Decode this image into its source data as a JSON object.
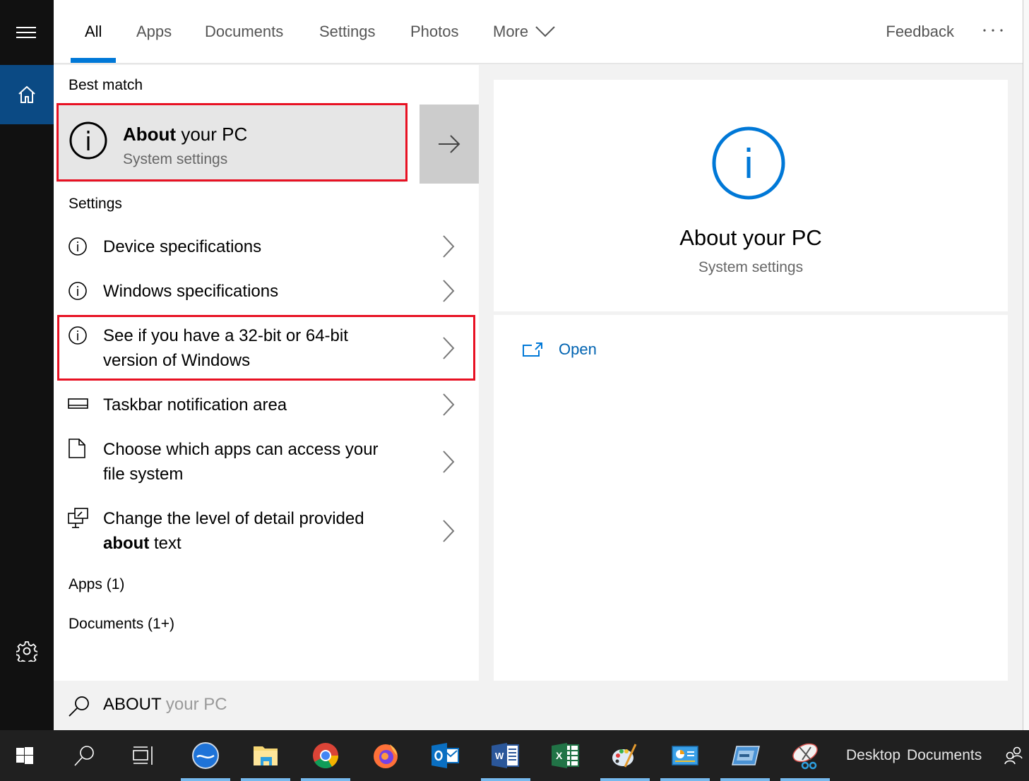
{
  "header": {
    "tabs": [
      {
        "label": "All",
        "active": true
      },
      {
        "label": "Apps"
      },
      {
        "label": "Documents"
      },
      {
        "label": "Settings"
      },
      {
        "label": "Photos"
      },
      {
        "label": "More"
      }
    ],
    "feedback_label": "Feedback",
    "more_options_icon": "ellipsis-icon"
  },
  "rail": {
    "menu_icon": "hamburger-icon",
    "home_icon": "home-icon",
    "settings_icon": "gear-icon"
  },
  "results": {
    "best_match_heading": "Best match",
    "best_match": {
      "title_bold": "About",
      "title_rest": " your PC",
      "subtitle": "System settings",
      "icon": "info-icon",
      "arrow_icon": "arrow-right-icon"
    },
    "settings_heading": "Settings",
    "settings_items": [
      {
        "icon": "info-icon",
        "line1": "Device specifications",
        "line2": ""
      },
      {
        "icon": "info-icon",
        "line1": "Windows specifications",
        "line2": ""
      },
      {
        "icon": "info-icon",
        "line1": "See if you have a 32-bit or 64-bit",
        "line2": "version of Windows",
        "highlighted": true
      },
      {
        "icon": "taskbar-icon",
        "line1": "Taskbar notification area",
        "line2": ""
      },
      {
        "icon": "document-icon",
        "line1": "Choose which apps can access your",
        "line2": "file system"
      },
      {
        "icon": "monitor-pen-icon",
        "line1": "Change the level of detail provided",
        "line2_bold": "about",
        "line2": " text"
      }
    ],
    "apps_heading": "Apps (1)",
    "documents_heading": "Documents (1+)"
  },
  "search": {
    "typed": "ABOUT",
    "suggestion": " your PC"
  },
  "preview": {
    "title": "About your PC",
    "subtitle": "System settings",
    "open_label": "Open"
  },
  "taskbar": {
    "apps": [
      {
        "name": "start",
        "running": false
      },
      {
        "name": "search",
        "running": false
      },
      {
        "name": "task-view",
        "running": false
      },
      {
        "name": "blue-orb-app",
        "running": true
      },
      {
        "name": "file-explorer",
        "running": true
      },
      {
        "name": "chrome",
        "running": true
      },
      {
        "name": "firefox",
        "running": false
      },
      {
        "name": "outlook",
        "running": false
      },
      {
        "name": "word",
        "running": true
      },
      {
        "name": "excel",
        "running": false
      },
      {
        "name": "paint",
        "running": true
      },
      {
        "name": "control-panel",
        "running": true
      },
      {
        "name": "display-app",
        "running": true
      },
      {
        "name": "snipping-tool",
        "running": true
      }
    ],
    "toolbar_desktop": "Desktop",
    "toolbar_documents": "Documents"
  },
  "colors": {
    "accent": "#0078d7",
    "highlight_border": "#e81123",
    "rail_active": "#0b4a84"
  }
}
